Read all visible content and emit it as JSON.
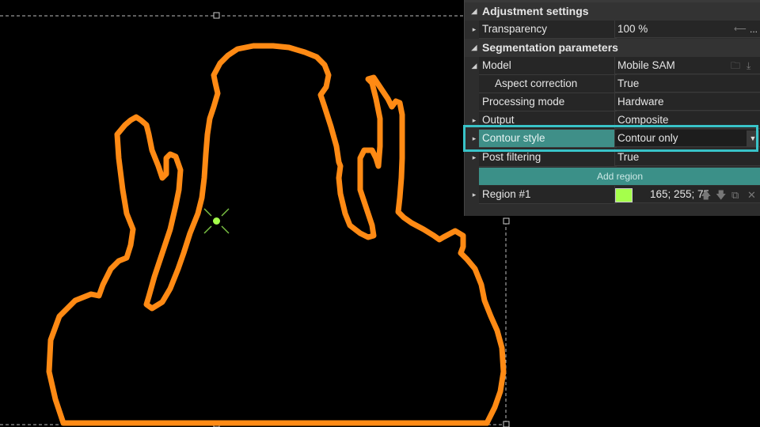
{
  "canvas": {
    "contour_color": "#ff8a14",
    "point_color": "#a5ff4b"
  },
  "panel": {
    "categories": {
      "adjustment": "Adjustment settings",
      "segmentation": "Segmentation parameters"
    },
    "properties": {
      "transparency": {
        "name": "Transparency",
        "value": "100 %"
      },
      "model": {
        "name": "Model",
        "value": "Mobile SAM"
      },
      "aspect_correction": {
        "name": "Aspect correction",
        "value": "True"
      },
      "processing_mode": {
        "name": "Processing mode",
        "value": "Hardware"
      },
      "output": {
        "name": "Output",
        "value": "Composite"
      },
      "contour_style": {
        "name": "Contour style",
        "value": "Contour only"
      },
      "post_filtering": {
        "name": "Post filtering",
        "value": "True"
      }
    },
    "add_region_label": "Add region",
    "region": {
      "name": "Region #1",
      "color": "#a5ff4b",
      "rgb_text": "165; 255; 75"
    },
    "glyphs": {
      "expand": "▸",
      "collapse": "◢",
      "dropdown": "▼",
      "ellipsis": "...",
      "slider": "⟵",
      "folder": "🗀",
      "download": "⤓",
      "up": "🡅",
      "down": "🡇",
      "copy": "⧉",
      "close": "✕"
    },
    "highlight_color": "#39c3c8"
  }
}
